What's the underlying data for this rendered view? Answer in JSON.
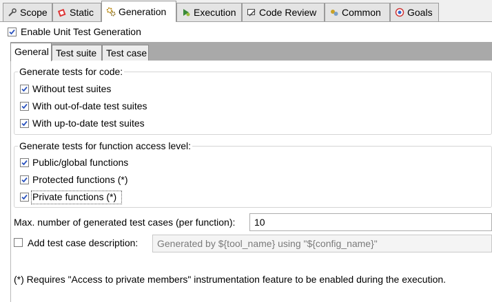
{
  "top_tabs": [
    {
      "label": "Scope",
      "icon": "wrench-icon"
    },
    {
      "label": "Static",
      "icon": "static-analysis-icon"
    },
    {
      "label": "Generation",
      "icon": "gears-icon"
    },
    {
      "label": "Execution",
      "icon": "run-icon"
    },
    {
      "label": "Code Review",
      "icon": "code-review-icon"
    },
    {
      "label": "Common",
      "icon": "common-icon"
    },
    {
      "label": "Goals",
      "icon": "target-icon"
    }
  ],
  "active_top_tab": "Generation",
  "enable_unit_test_generation": {
    "label": "Enable Unit Test Generation",
    "checked": true
  },
  "inner_tabs": [
    "General",
    "Test suite",
    "Test case"
  ],
  "active_inner_tab": "General",
  "code_group": {
    "title": "Generate tests for code:",
    "options": [
      {
        "label": "Without test suites",
        "checked": true
      },
      {
        "label": "With out-of-date test suites",
        "checked": true
      },
      {
        "label": "With up-to-date test suites",
        "checked": true
      }
    ]
  },
  "access_group": {
    "title": "Generate tests for function access level:",
    "options": [
      {
        "label": "Public/global functions",
        "checked": true
      },
      {
        "label": "Protected functions (*)",
        "checked": true
      },
      {
        "label": "Private functions (*)",
        "checked": true
      }
    ]
  },
  "max_cases": {
    "label": "Max. number of generated test cases (per function):",
    "value": "10"
  },
  "description": {
    "label": "Add test case description:",
    "checked": false,
    "value": "Generated by ${tool_name} using \"${config_name}\""
  },
  "footnote": "(*) Requires \"Access to private members\" instrumentation feature to be enabled during the execution.",
  "colors": {
    "check": "#2a52be",
    "tab_bar": "#a9a9a9"
  }
}
